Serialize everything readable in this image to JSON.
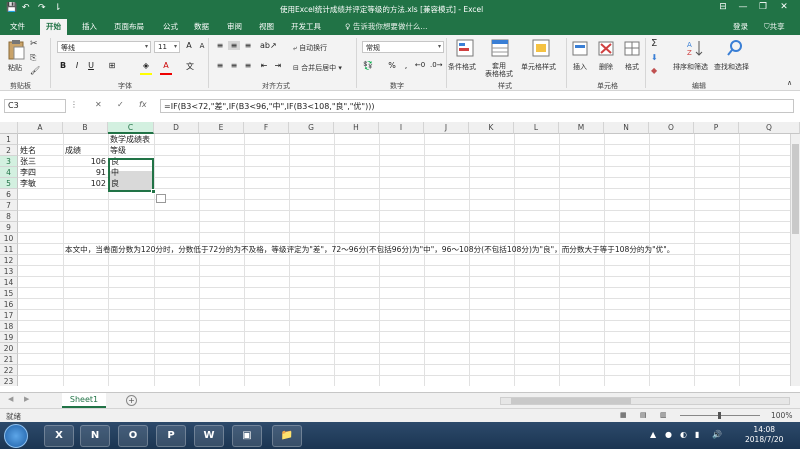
{
  "window": {
    "title": "使用Excel统计成绩并评定等级的方法.xls [兼容模式] - Excel",
    "signin": "登录",
    "share": "共享",
    "minimize": "—",
    "restore": "❐",
    "close": "✕",
    "ribbon_options": "⊟"
  },
  "quick_access": {
    "save": "💾",
    "undo": "↶",
    "redo": "↷",
    "customize": "⇂"
  },
  "tabs": [
    {
      "label": "文件"
    },
    {
      "label": "开始"
    },
    {
      "label": "插入"
    },
    {
      "label": "页面布局"
    },
    {
      "label": "公式"
    },
    {
      "label": "数据"
    },
    {
      "label": "审阅"
    },
    {
      "label": "视图"
    },
    {
      "label": "开发工具"
    }
  ],
  "tell_me": "♀ 告诉我你想要做什么...",
  "ribbon": {
    "clipboard": {
      "label": "剪贴板",
      "paste": "粘贴"
    },
    "font": {
      "label": "字体",
      "name": "等线",
      "size": "11",
      "bold": "B",
      "italic": "I",
      "underline": "U",
      "grow": "A",
      "shrink": "A"
    },
    "alignment": {
      "label": "对齐方式",
      "wrap": "自动换行",
      "merge": "合并后居中"
    },
    "number": {
      "label": "数字",
      "format": "常规",
      "percent": "%",
      "comma": ","
    },
    "styles": {
      "label": "样式",
      "conditional": "条件格式",
      "table": "套用\n表格格式",
      "cell_styles": "单元格样式"
    },
    "cells": {
      "label": "单元格",
      "insert": "插入",
      "delete": "删除",
      "format": "格式"
    },
    "editing": {
      "label": "编辑",
      "sort": "排序和筛选",
      "find": "查找和选择",
      "sum": "Σ"
    }
  },
  "formula_bar": {
    "name_box": "C3",
    "cancel": "✕",
    "enter": "✓",
    "fx": "fx",
    "formula": "=IF(B3<72,\"差\",IF(B3<96,\"中\",IF(B3<108,\"良\",\"优\")))"
  },
  "columns": [
    "A",
    "B",
    "C",
    "D",
    "E",
    "F",
    "G",
    "H",
    "I",
    "J",
    "K",
    "L",
    "M",
    "N",
    "O",
    "P",
    "Q"
  ],
  "rows": [
    "1",
    "2",
    "3",
    "4",
    "5",
    "6",
    "7",
    "8",
    "9",
    "10",
    "11",
    "12",
    "13",
    "14",
    "15",
    "16",
    "17",
    "18",
    "19",
    "20",
    "21",
    "22",
    "23"
  ],
  "cells": {
    "c1": "数学成绩表",
    "a2": "姓名",
    "b2": "成绩",
    "c2": "等级",
    "a3": "张三",
    "b3": "106",
    "c3": "良",
    "a4": "李四",
    "b4": "91",
    "c4": "中",
    "a5": "李敏",
    "b5": "102",
    "c5": "良",
    "b10": "本文中，当卷面分数为120分时，分数低于72分的为不及格，等级评定为\"差\"，72～96分(不包括96分)为\"中\"，96～108分(不包括108分)为\"良\"，而分数大于等于108分的为\"优\"。"
  },
  "sheets": [
    {
      "name": "Sheet1"
    }
  ],
  "add_sheet": "+",
  "status": {
    "ready": "就绪",
    "zoom": "100%"
  },
  "taskbar": {
    "apps": [
      {
        "name": "Excel",
        "letter": "X",
        "color": "#1f7244"
      },
      {
        "name": "OneNote",
        "letter": "N",
        "color": "#7a3b91"
      },
      {
        "name": "Outlook",
        "letter": "O",
        "color": "#0a64b0"
      },
      {
        "name": "PowerPoint",
        "letter": "P",
        "color": "#c8472a"
      },
      {
        "name": "Word",
        "letter": "W",
        "color": "#2b579a"
      }
    ],
    "time": "14:08",
    "date": "2018/7/20"
  },
  "colors": {
    "excel_green": "#217346",
    "selection": "#217346"
  }
}
